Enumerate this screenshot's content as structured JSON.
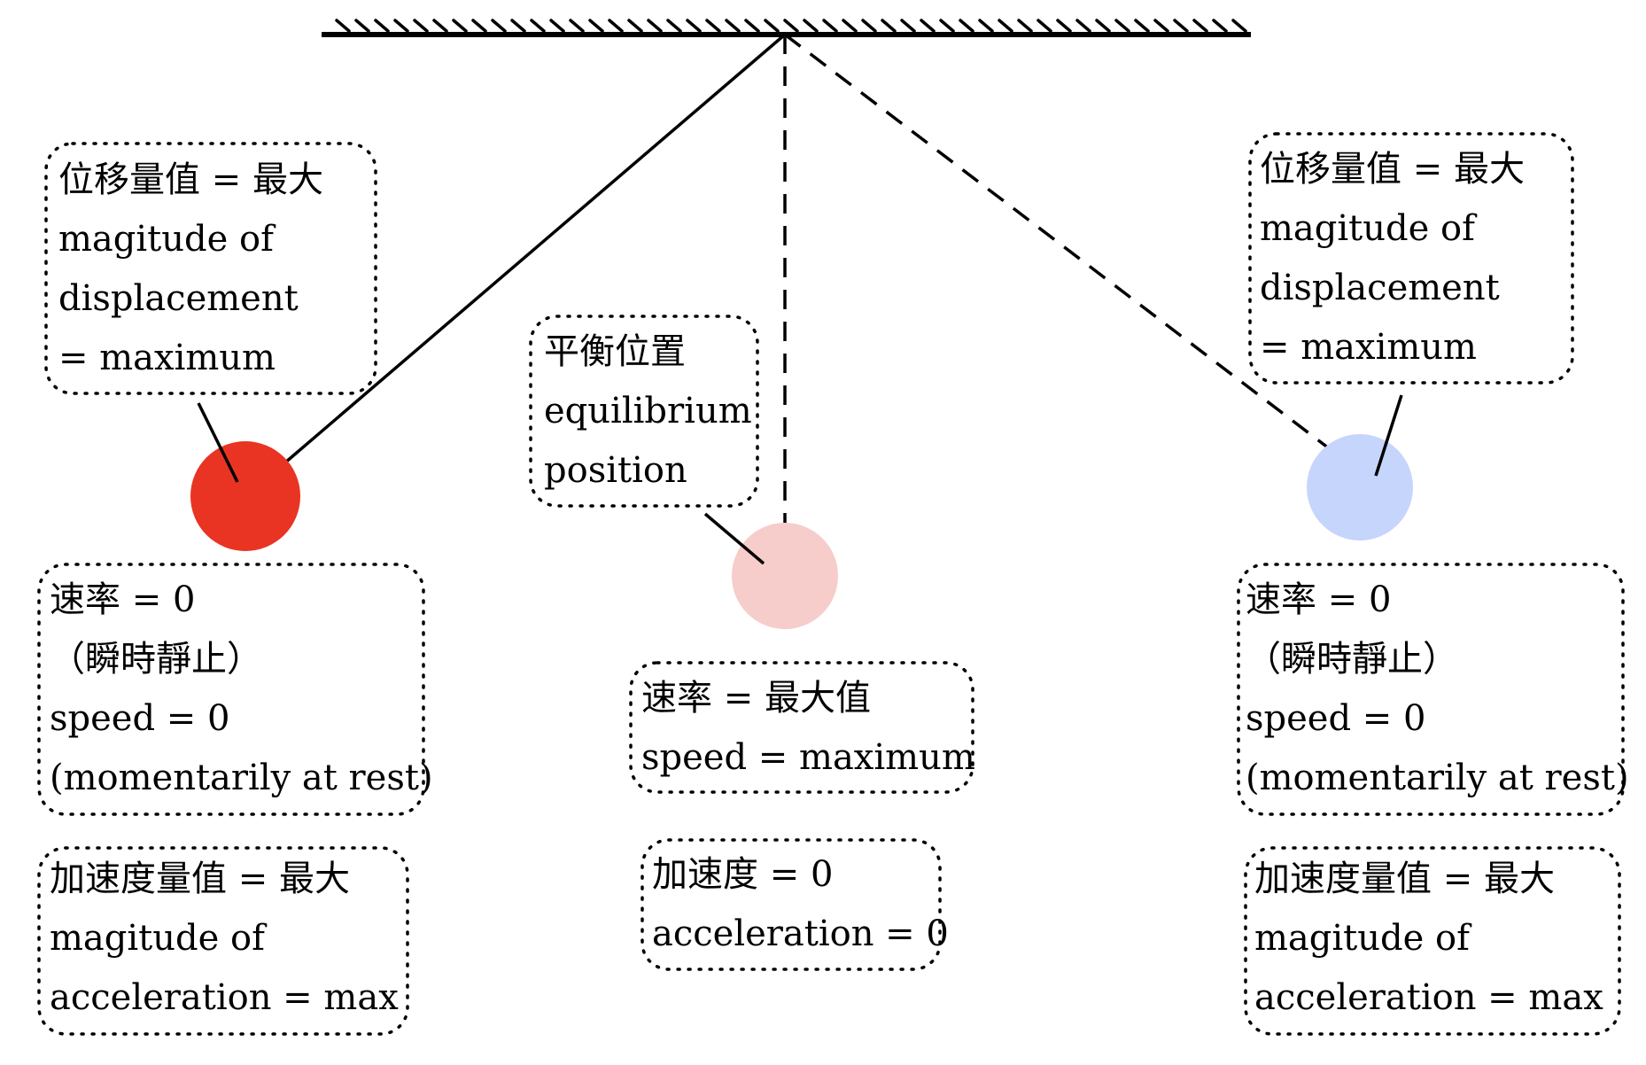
{
  "colors": {
    "bob_left": "#e93423",
    "bob_center": "#f6cdca",
    "bob_right": "#c6d5fb",
    "line": "#000000"
  },
  "labels": {
    "left_top": [
      "位移量值 = 最大",
      "magitude of",
      "displacement",
      "= maximum"
    ],
    "center_top": [
      "平衡位置",
      "equilibrium",
      "position"
    ],
    "right_top": [
      "位移量值 = 最大",
      "magitude of",
      "displacement",
      "= maximum"
    ],
    "left_speed": [
      "速率 = 0",
      "（瞬時靜止）",
      "speed = 0",
      "(momentarily at rest)"
    ],
    "center_speed": [
      "速率 = 最大值",
      "speed = maximum"
    ],
    "right_speed": [
      "速率 = 0",
      "（瞬時靜止）",
      "speed = 0",
      "(momentarily at rest)"
    ],
    "left_accel": [
      "加速度量值 = 最大",
      "magitude of",
      "acceleration = max"
    ],
    "center_accel": [
      "加速度 = 0",
      "acceleration = 0"
    ],
    "right_accel": [
      "加速度量值 = 最大",
      "magitude of",
      "acceleration = max"
    ]
  }
}
